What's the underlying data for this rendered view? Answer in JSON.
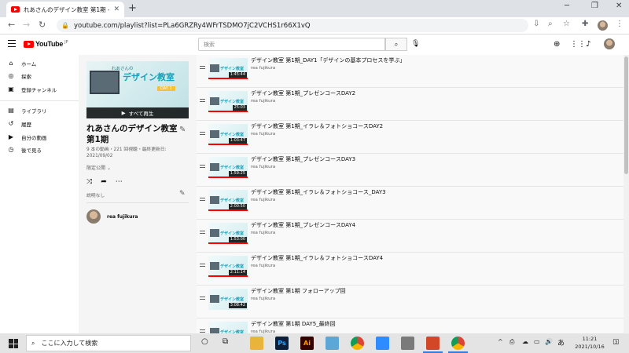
{
  "browser": {
    "tab_title": "れあさんのデザイン教室 第1期 - YouTube",
    "tab_close": "✕",
    "new_tab": "+",
    "url": "youtube.com/playlist?list=PLa6GRZRy4WFrTSDMO7jC2VCHS1r66X1vQ",
    "window_controls": [
      "─",
      "❐",
      "✕"
    ]
  },
  "yt_header": {
    "logo_text": "YouTube",
    "logo_sup": "JP",
    "search_placeholder": "検索"
  },
  "sidebar": {
    "items": [
      {
        "label": "ホーム",
        "icon": "home-icon",
        "glyph": "⌂"
      },
      {
        "label": "探索",
        "icon": "compass-icon",
        "glyph": "◎"
      },
      {
        "label": "登録チャンネル",
        "icon": "subscriptions-icon",
        "glyph": "▣"
      },
      {
        "label": "ライブラリ",
        "icon": "library-icon",
        "glyph": "▤"
      },
      {
        "label": "履歴",
        "icon": "history-icon",
        "glyph": "↺"
      },
      {
        "label": "自分の動画",
        "icon": "my-videos-icon",
        "glyph": "▶"
      },
      {
        "label": "後で見る",
        "icon": "watch-later-icon",
        "glyph": "◷"
      }
    ]
  },
  "playlist": {
    "thumb_small": "れあさんの",
    "thumb_big": "デザイン教室",
    "thumb_day": "DAY 1",
    "play_all": "すべて再生",
    "title": "れあさんのデザイン教室 第1期",
    "meta": "9 本の動画・221 回視聴・最終更新日: 2021/09/02",
    "privacy": "限定公開",
    "description": "説明なし",
    "owner": "rea fujikura"
  },
  "videos": [
    {
      "title": "デザイン教室 第1期_DAY1「デザインの基本プロセスを学ぶ」",
      "channel": "rea fujikura",
      "duration": "1:45:44",
      "watched": 1.0
    },
    {
      "title": "デザイン教室 第1期_プレゼンコースDAY2",
      "channel": "rea fujikura",
      "duration": "25:03",
      "watched": 1.0
    },
    {
      "title": "デザイン教室 第1期_イラレ＆フォトショコースDAY2",
      "channel": "rea fujikura",
      "duration": "1:03:47",
      "watched": 1.0
    },
    {
      "title": "デザイン教室 第1期_プレゼンコースDAY3",
      "channel": "rea fujikura",
      "duration": "1:59:25",
      "watched": 1.0
    },
    {
      "title": "デザイン教室 第1期_イラレ＆フォトショコース_DAY3",
      "channel": "rea fujikura",
      "duration": "2:00:50",
      "watched": 1.0
    },
    {
      "title": "デザイン教室 第1期_プレゼンコースDAY4",
      "channel": "rea fujikura",
      "duration": "1:53:00",
      "watched": 1.0
    },
    {
      "title": "デザイン教室 第1期_イラレ＆フォトショコースDAY4",
      "channel": "rea fujikura",
      "duration": "2:11:14",
      "watched": 1.0
    },
    {
      "title": "デザイン教室 第1期 フォローアップ回",
      "channel": "rea fujikura",
      "duration": "3:08:42",
      "watched": 0.0
    },
    {
      "title": "デザイン教室 第1期 DAY5_最終回",
      "channel": "rea fujikura",
      "duration": "",
      "watched": 0.0
    }
  ],
  "taskbar": {
    "search_placeholder": "ここに入力して検索",
    "time": "11:21",
    "date": "2021/10/16",
    "ime": "あ",
    "notification_count": "3",
    "apps": [
      {
        "name": "explorer",
        "label": "",
        "color": "#e8b43a"
      },
      {
        "name": "photoshop",
        "label": "Ps",
        "color": "#0b1f3a"
      },
      {
        "name": "illustrator",
        "label": "Ai",
        "color": "#330000"
      },
      {
        "name": "pen-app",
        "label": "",
        "color": "#5aa7d8"
      },
      {
        "name": "chrome",
        "label": "",
        "color": "#dddddd"
      },
      {
        "name": "zoom",
        "label": "",
        "color": "#2d8cff"
      },
      {
        "name": "printer-app",
        "label": "",
        "color": "#7a7a7a"
      },
      {
        "name": "powerpoint",
        "label": "",
        "color": "#d24726"
      },
      {
        "name": "chrome-active",
        "label": "",
        "color": "#dddddd"
      }
    ]
  }
}
